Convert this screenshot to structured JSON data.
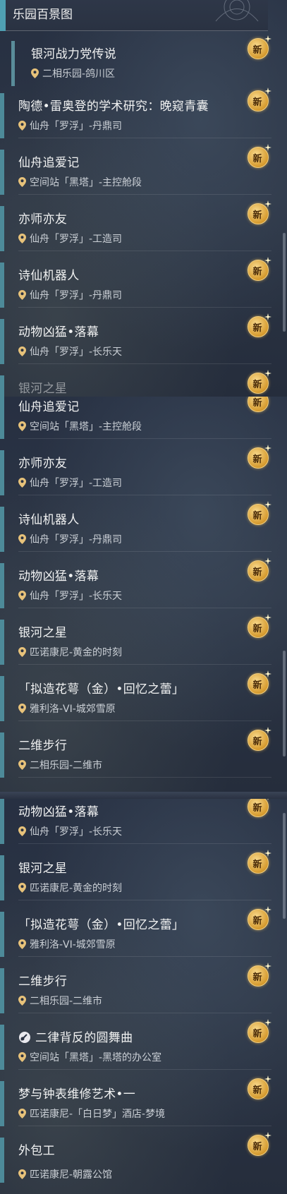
{
  "header": {
    "title": "乐园百景图"
  },
  "badge_label": "新",
  "colors": {
    "accent": "#4d8a99",
    "badge": "#d69b2f",
    "text": "#f1f2f2"
  },
  "panel1": {
    "items": [
      {
        "title": "银河战力党传说",
        "loc": "二相乐园-鸽川区"
      },
      {
        "title": "陶德•雷奥登的学术研究：晚窥青囊",
        "loc": "仙舟「罗浮」-丹鼎司"
      },
      {
        "title": "仙舟追爱记",
        "loc": "空间站「黑塔」-主控舱段"
      },
      {
        "title": "亦师亦友",
        "loc": "仙舟「罗浮」-工造司"
      },
      {
        "title": "诗仙机器人",
        "loc": "仙舟「罗浮」-丹鼎司"
      },
      {
        "title": "动物凶猛•落幕",
        "loc": "仙舟「罗浮」-长乐天"
      },
      {
        "title": "银河之星",
        "loc": ""
      }
    ]
  },
  "panel2": {
    "items": [
      {
        "title": "仙舟追爱记",
        "loc": "空间站「黑塔」-主控舱段"
      },
      {
        "title": "亦师亦友",
        "loc": "仙舟「罗浮」-工造司"
      },
      {
        "title": "诗仙机器人",
        "loc": "仙舟「罗浮」-丹鼎司"
      },
      {
        "title": "动物凶猛•落幕",
        "loc": "仙舟「罗浮」-长乐天"
      },
      {
        "title": "银河之星",
        "loc": "匹诺康尼-黄金的时刻"
      },
      {
        "title": "「拟造花萼（金）•回忆之蕾」",
        "loc": "雅利洛-VI-城郊雪原"
      },
      {
        "title": "二维步行",
        "loc": "二相乐园-二维市"
      }
    ]
  },
  "panel3": {
    "items": [
      {
        "title": "动物凶猛•落幕",
        "loc": "仙舟「罗浮」-长乐天"
      },
      {
        "title": "银河之星",
        "loc": "匹诺康尼-黄金的时刻"
      },
      {
        "title": "「拟造花萼（金）•回忆之蕾」",
        "loc": "雅利洛-VI-城郊雪原"
      },
      {
        "title": "二维步行",
        "loc": "二相乐园-二维市"
      },
      {
        "title": "二律背反的圆舞曲",
        "loc": "空间站「黑塔」-黑塔的办公室",
        "icon": "guitar-icon"
      },
      {
        "title": "梦与钟表维修艺术•一",
        "loc": "匹诺康尼-「白日梦」酒店-梦境"
      },
      {
        "title": "外包工",
        "loc": "匹诺康尼-朝露公馆"
      }
    ]
  }
}
